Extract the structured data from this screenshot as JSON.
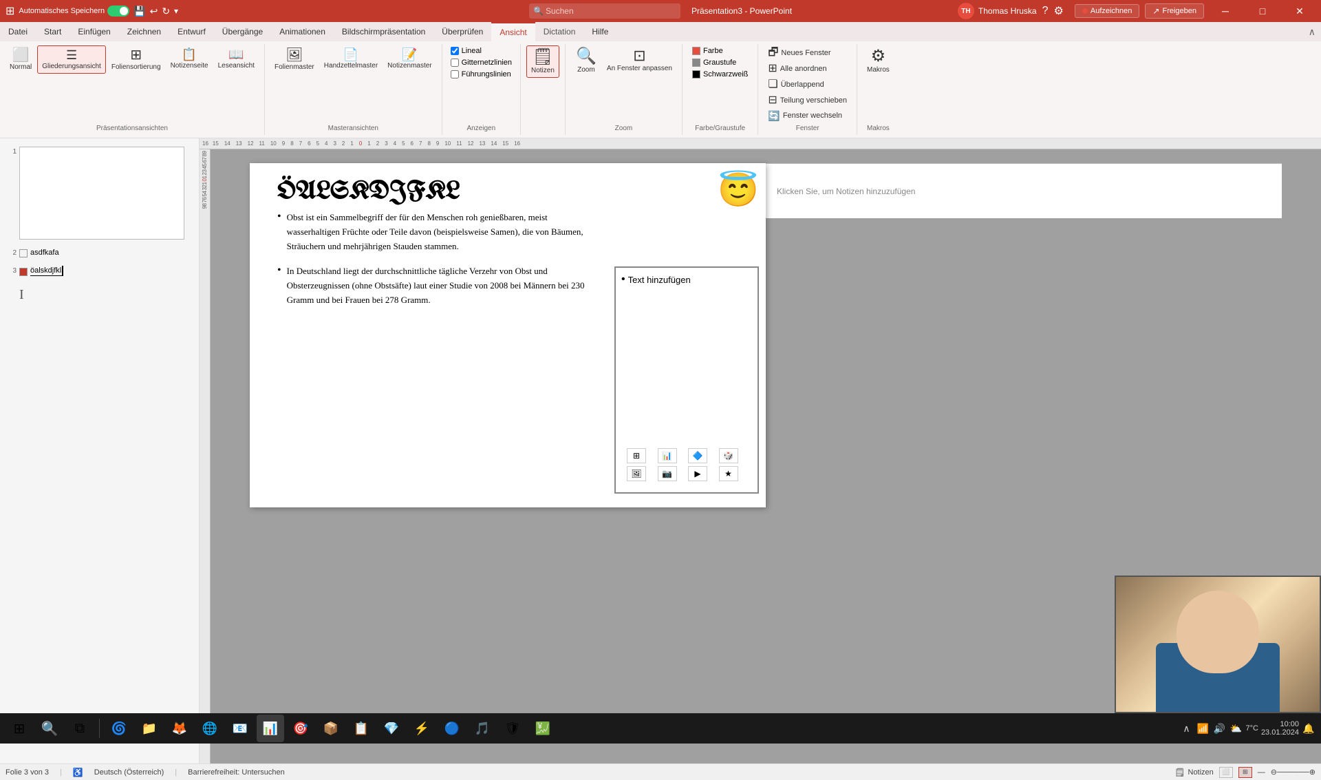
{
  "titlebar": {
    "autosave_label": "Automatisches Speichern",
    "toggle_state": "on",
    "app_name": "Präsentation3 - PowerPoint",
    "search_placeholder": "Suchen",
    "user_name": "Thomas Hruska",
    "user_initials": "TH",
    "btn_minimize": "─",
    "btn_maximize": "□",
    "btn_close": "✕"
  },
  "ribbon": {
    "tabs": [
      {
        "label": "Datei",
        "active": false
      },
      {
        "label": "Start",
        "active": false
      },
      {
        "label": "Einfügen",
        "active": false
      },
      {
        "label": "Zeichnen",
        "active": false
      },
      {
        "label": "Entwurf",
        "active": false
      },
      {
        "label": "Übergänge",
        "active": false
      },
      {
        "label": "Animationen",
        "active": false
      },
      {
        "label": "Bildschirmpräsentation",
        "active": false
      },
      {
        "label": "Überprüfen",
        "active": false
      },
      {
        "label": "Ansicht",
        "active": true
      },
      {
        "label": "Dictation",
        "active": false
      },
      {
        "label": "Hilfe",
        "active": false
      }
    ],
    "groups": {
      "presentation_views": {
        "label": "Präsentationsansichten",
        "buttons": [
          {
            "id": "normal",
            "label": "Normal",
            "icon": "⬜"
          },
          {
            "id": "outline",
            "label": "Gliederungsansicht",
            "icon": "☰",
            "active": true
          },
          {
            "id": "slide_sorter",
            "label": "Foliensortierung",
            "icon": "⊞"
          },
          {
            "id": "notes_page",
            "label": "Notizenseite",
            "icon": "📋"
          },
          {
            "id": "reading",
            "label": "Leseansicht",
            "icon": "📖"
          }
        ]
      },
      "master_views": {
        "label": "Masteransichten",
        "buttons": [
          {
            "id": "slide_master",
            "label": "Folienmaster",
            "icon": "🖼"
          },
          {
            "id": "handout_master",
            "label": "Handzettelmaster",
            "icon": "📄"
          },
          {
            "id": "notes_master",
            "label": "Notizenmaster",
            "icon": "📝"
          }
        ]
      },
      "show": {
        "label": "Anzeigen",
        "checkboxes": [
          {
            "id": "ruler",
            "label": "Lineal",
            "checked": true
          },
          {
            "id": "grid",
            "label": "Gitternetzlinien",
            "checked": false
          },
          {
            "id": "guides",
            "label": "Führungslinien",
            "checked": false
          }
        ]
      },
      "notes_btn": {
        "label": "Notizen",
        "icon": "🗒",
        "active": true
      },
      "zoom": {
        "label": "Zoom",
        "buttons": [
          {
            "id": "zoom",
            "label": "Zoom",
            "icon": "🔍"
          },
          {
            "id": "fit_window",
            "label": "An Fenster anpassen",
            "icon": "⊡"
          }
        ]
      },
      "color_grayscale": {
        "label": "Farbe/Graustufe",
        "options": [
          {
            "id": "color",
            "label": "Farbe",
            "color": "#e74c3c"
          },
          {
            "id": "grayscale",
            "label": "Graustufe",
            "color": "#888"
          },
          {
            "id": "bw",
            "label": "Schwarzweiß",
            "color": "#000"
          }
        ]
      },
      "window": {
        "label": "Fenster",
        "buttons": [
          {
            "id": "new_window",
            "label": "Neues Fenster",
            "icon": "🗗"
          },
          {
            "id": "arrange_all",
            "label": "Alle anordnen",
            "icon": "⊞"
          },
          {
            "id": "cascade",
            "label": "Überlappend",
            "icon": "❏"
          },
          {
            "id": "move_split",
            "label": "Teilung verschieben",
            "icon": "⊟"
          },
          {
            "id": "switch_window",
            "label": "Fenster wechseln",
            "icon": "🔄"
          }
        ]
      },
      "macros": {
        "label": "Makros",
        "buttons": [
          {
            "id": "macros",
            "label": "Makros",
            "icon": "⚙"
          }
        ]
      }
    }
  },
  "slides": [
    {
      "num": "1",
      "active": false,
      "has_icon": false,
      "icon_color": ""
    },
    {
      "num": "2",
      "active": false,
      "has_icon": false,
      "icon_color": "",
      "title": "asdfkafa"
    },
    {
      "num": "3",
      "active": true,
      "has_icon": true,
      "icon_color": "red",
      "title": "öalskdjfkl"
    }
  ],
  "current_slide": {
    "title": "ÖALSKDJFKL",
    "bullets": [
      {
        "text": "Obst ist ein Sammelbegriff der für den Menschen roh genießbaren, meist wasserhaltigen Früchte oder Teile davon (beispielsweise Samen), die von Bäumen, Sträuchern und mehrjährigen Stauden stammen."
      },
      {
        "text": "In Deutschland liegt der durchschnittliche tägliche Verzehr von Obst und Obsterzeugnissen (ohne Obstsäfte) laut einer Studie von 2008 bei Männern bei 230 Gramm und bei Frauen bei 278 Gramm."
      }
    ],
    "content_box": {
      "title": "Text hinzufügen"
    },
    "smiley": "😇"
  },
  "notes": {
    "placeholder": "Klicken Sie, um Notizen hinzuzufügen"
  },
  "statusbar": {
    "slide_info": "Folie 3 von 3",
    "language": "Deutsch (Österreich)",
    "accessibility": "Barrierefreiheit: Untersuchen",
    "notes_label": "Notizen"
  },
  "record_btn": "Aufzeichnen",
  "share_btn": "Freigeben",
  "taskbar": {
    "clock": "7°C\n10:00\n23.01.2024"
  }
}
